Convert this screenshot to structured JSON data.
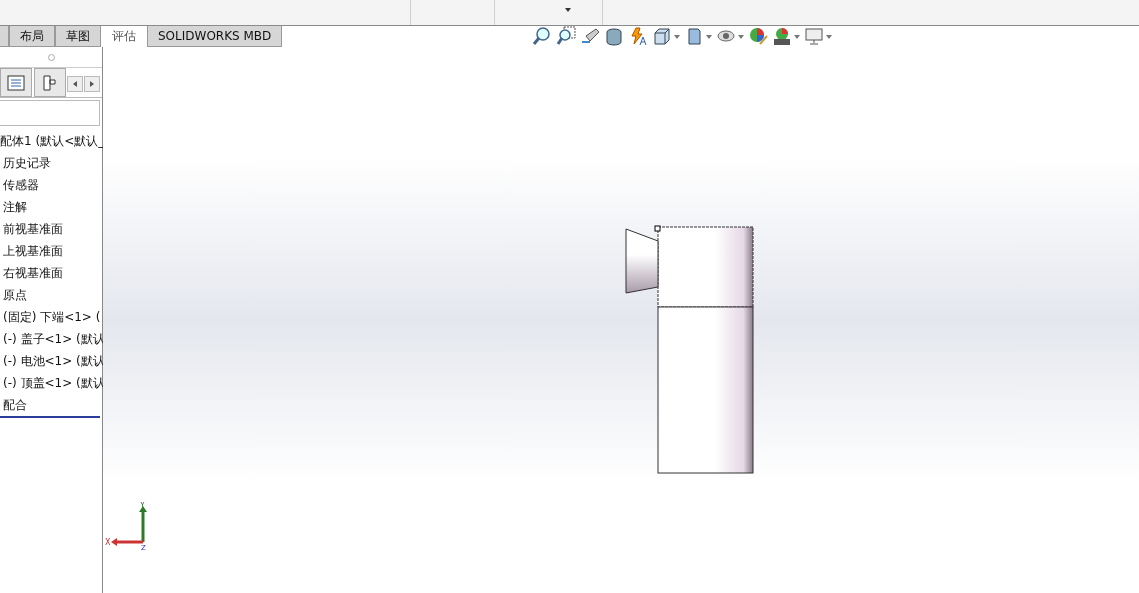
{
  "tabs": [
    {
      "label": "布局",
      "selected": false
    },
    {
      "label": "草图",
      "selected": false
    },
    {
      "label": "评估",
      "selected": true
    },
    {
      "label": "SOLIDWORKS MBD",
      "selected": false
    }
  ],
  "tree": {
    "root": "配体1 (默认<默认_",
    "children": [
      {
        "label": "历史记录"
      },
      {
        "label": "传感器"
      },
      {
        "label": "注解"
      },
      {
        "label": "前视基准面"
      },
      {
        "label": "上视基准面"
      },
      {
        "label": "右视基准面"
      },
      {
        "label": "原点"
      },
      {
        "label": "(固定) 下端<1> ("
      },
      {
        "label": "(-) 盖子<1> (默认"
      },
      {
        "label": "(-) 电池<1> (默认"
      },
      {
        "label": "(-) 顶盖<1> (默认"
      },
      {
        "label": "配合"
      }
    ]
  },
  "triad": {
    "x_label": "X",
    "y_label": "Y",
    "z_label": "Z"
  }
}
